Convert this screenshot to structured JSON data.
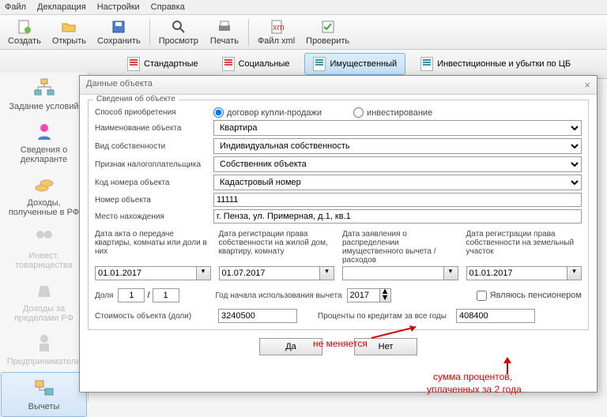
{
  "menu": {
    "file": "Файл",
    "decl": "Декларация",
    "settings": "Настройки",
    "help": "Справка"
  },
  "toolbar": {
    "create": "Создать",
    "open": "Открыть",
    "save": "Сохранить",
    "view": "Просмотр",
    "print": "Печать",
    "filexml": "Файл xml",
    "check": "Проверить"
  },
  "subtabs": {
    "std": "Стандартные",
    "soc": "Социальные",
    "prop": "Имущественный",
    "inv": "Инвестиционные и убытки по ЦБ"
  },
  "sidebar": {
    "items": [
      {
        "label": "Задание условий"
      },
      {
        "label": "Сведения о декларанте"
      },
      {
        "label": "Доходы, полученные в РФ"
      },
      {
        "label": "Инвест. товарищества"
      },
      {
        "label": "Доходы за пределами РФ"
      },
      {
        "label": "Предприниматели"
      },
      {
        "label": "Вычеты"
      }
    ]
  },
  "dialog": {
    "title": "Данные объекта",
    "group_legend": "Сведения об объекте",
    "acq_method_label": "Способ приобретения",
    "radio1": "договор купли-продажи",
    "radio2": "инвестирование",
    "obj_name_label": "Наименование объекта",
    "obj_name_value": "Квартира",
    "own_type_label": "Вид собственности",
    "own_type_value": "Индивидуальная собственность",
    "taxpayer_label": "Признак налогоплательщика",
    "taxpayer_value": "Собственник объекта",
    "code_label": "Код номера объекта",
    "code_value": "Кадастровый номер",
    "num_label": "Номер объекта",
    "num_value": "11111",
    "loc_label": "Место нахождения",
    "loc_value": "г. Пенза, ул. Примерная, д.1, кв.1",
    "date1_label": "Дата акта о передаче квартиры, комнаты или доли в них",
    "date1_value": "01.01.2017",
    "date2_label": "Дата регистрации права собственности на жилой дом, квартиру, комнату",
    "date2_value": "01.07.2017",
    "date3_label": "Дата заявления о распределении имущественного вычета / расходов",
    "date3_value": "",
    "date4_label": "Дата регистрации права собственности на земельный участок",
    "date4_value": "01.01.2017",
    "share_label": "Доля",
    "share_a": "1",
    "share_b": "1",
    "year_label": "Год начала использования вычета",
    "year_value": "2017",
    "pension_label": "Являюсь пенсионером",
    "cost_label": "Стоимость объекта (доли)",
    "cost_value": "3240500",
    "interest_label": "Проценты по кредитам за все годы",
    "interest_value": "408400",
    "ok": "Да",
    "cancel": "Нет"
  },
  "annotations": {
    "a1": "не меняется",
    "a2": "сумма процентов,",
    "a3": "уплаченных за 2 года"
  }
}
